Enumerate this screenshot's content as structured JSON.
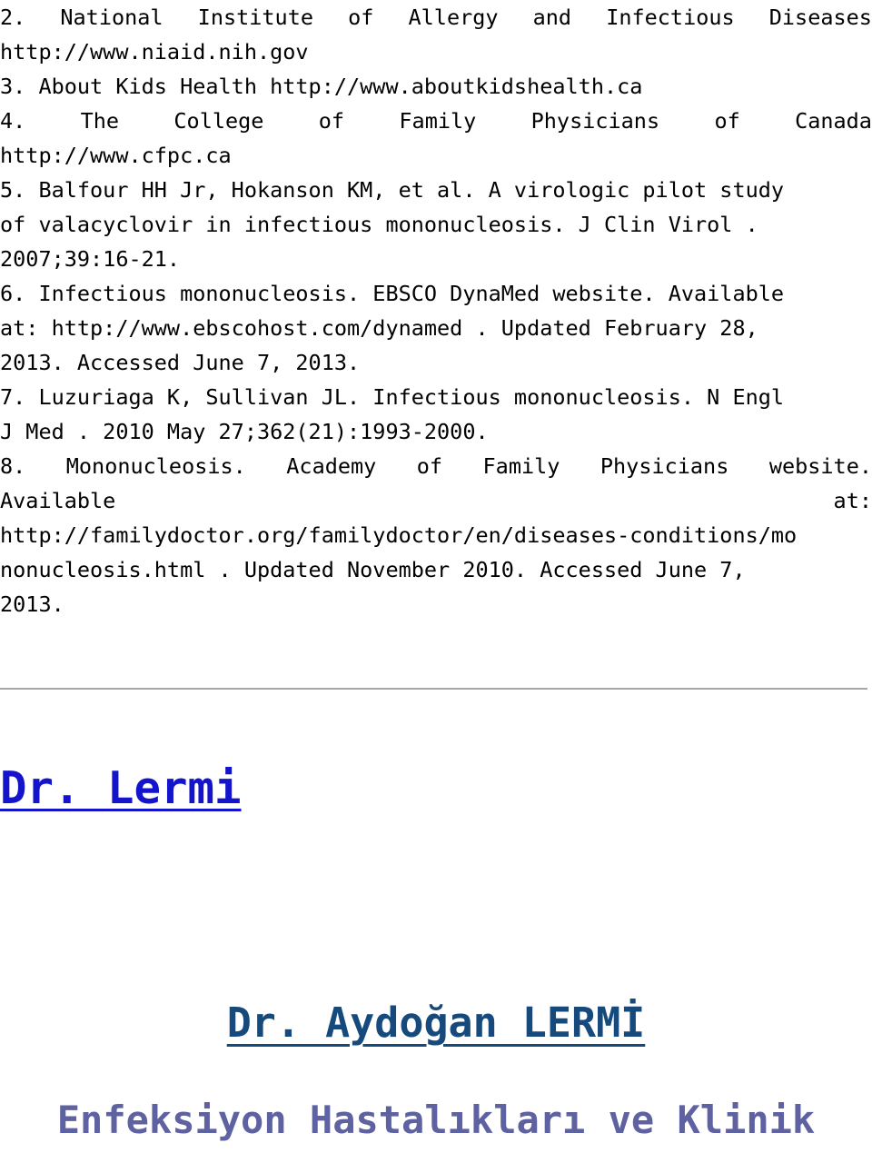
{
  "document": {
    "type": "reference-list-page",
    "background_color": "#ffffff",
    "body_text_color": "#000000"
  },
  "references": {
    "lines": [
      {
        "id": "ref-2-line-1",
        "text": "2. National Institute of Allergy and Infectious Diseases",
        "justified": true,
        "words": [
          "2.",
          "National",
          "Institute",
          "of",
          "Allergy",
          "and",
          "Infectious",
          "Diseases"
        ]
      },
      {
        "id": "ref-2-line-2",
        "text": "http://www.niaid.nih.gov",
        "justified": false
      },
      {
        "id": "ref-3-line-1",
        "text": "3. About Kids Health http://www.aboutkidshealth.ca",
        "justified": false
      },
      {
        "id": "ref-4-line-1",
        "text": "4. The College of Family Physicians of Canada",
        "justified": true,
        "words": [
          "4.",
          "The",
          "College",
          "of",
          "Family",
          "Physicians",
          "of",
          "Canada"
        ]
      },
      {
        "id": "ref-4-line-2",
        "text": "http://www.cfpc.ca",
        "justified": false
      },
      {
        "id": "ref-5-line-1",
        "text": "5. Balfour HH Jr, Hokanson KM, et al. A virologic pilot study",
        "justified": false
      },
      {
        "id": "ref-5-line-2",
        "text": "of valacyclovir in infectious mononucleosis. J Clin Virol .",
        "justified": false
      },
      {
        "id": "ref-5-line-3",
        "text": "2007;39:16-21.",
        "justified": false
      },
      {
        "id": "ref-6-line-1",
        "text": "6. Infectious mononucleosis. EBSCO DynaMed website. Available",
        "justified": false
      },
      {
        "id": "ref-6-line-2",
        "text": "at: http://www.ebscohost.com/dynamed . Updated February 28,",
        "justified": false
      },
      {
        "id": "ref-6-line-3",
        "text": "2013. Accessed June 7, 2013.",
        "justified": false
      },
      {
        "id": "ref-7-line-1",
        "text": "7. Luzuriaga K, Sullivan JL. Infectious mononucleosis. N Engl",
        "justified": false
      },
      {
        "id": "ref-7-line-2",
        "text": "J Med . 2010 May 27;362(21):1993-2000.",
        "justified": false
      },
      {
        "id": "ref-8-line-1",
        "text": "8. Mononucleosis. Academy of Family Physicians website.",
        "justified": true,
        "words": [
          "8.",
          "Mononucleosis.",
          "Academy",
          "of",
          "Family",
          "Physicians",
          "website."
        ]
      },
      {
        "id": "ref-8-line-2",
        "text": "Available                                             at:",
        "justified": true,
        "words": [
          "Available",
          "at:"
        ]
      },
      {
        "id": "ref-8-line-3",
        "text": "http://familydoctor.org/familydoctor/en/diseases-conditions/mo",
        "justified": false
      },
      {
        "id": "ref-8-line-4",
        "text": "nonucleosis.html . Updated November 2010. Accessed June 7,",
        "justified": false
      },
      {
        "id": "ref-8-line-5",
        "text": "2013.",
        "justified": false
      }
    ]
  },
  "divider": {
    "color": "#a6a6a6",
    "thickness": "2px"
  },
  "signature": {
    "link_label": "Dr. Lermi",
    "link_color": "#1414cc",
    "name": "Dr. Aydoğan LERMİ",
    "name_color": "#174a7c",
    "role": "Enfeksiyon Hastalıkları ve Klinik",
    "role_color": "#5f62a0"
  }
}
